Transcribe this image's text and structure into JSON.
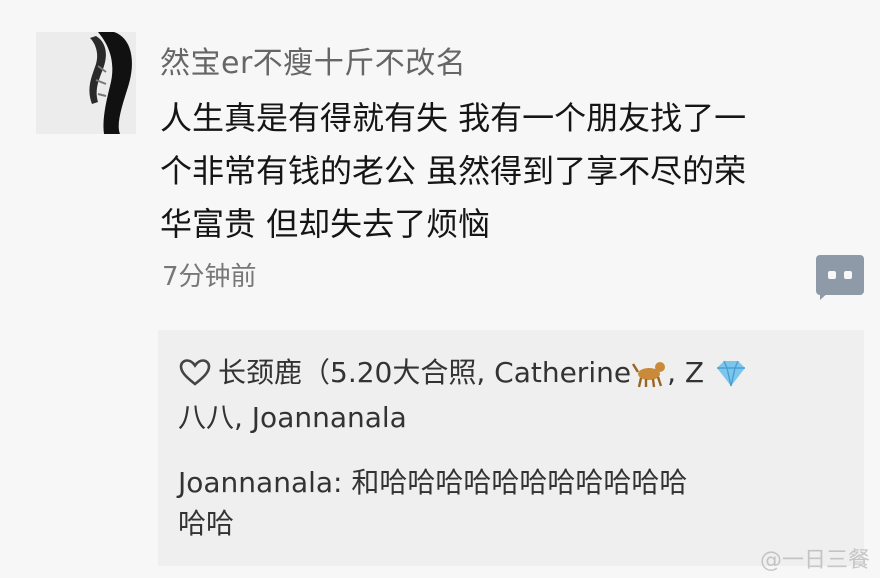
{
  "post": {
    "username": "然宝er不瘦十斤不改名",
    "content_lines": [
      "人生真是有得就有失 我有一个朋友找了一",
      "个非常有钱的老公 虽然得到了享不尽的荣",
      "华富贵 但却失去了烦恼"
    ],
    "time": "7分钟前"
  },
  "likes": {
    "row1_text": "长颈鹿（5.20大合照, Catherine",
    "row1_tail": ", Z ",
    "row2_text": "八八, Joannanala",
    "icons": [
      "heart-outline-icon",
      "dog-emoji-icon",
      "diamond-emoji-icon"
    ]
  },
  "reply": {
    "lines": [
      "Joannanala: 和哈哈哈哈哈哈哈哈哈哈哈",
      "哈哈"
    ]
  },
  "watermark": "@一日三餐",
  "colors": {
    "background": "#f7f7f7",
    "reply_box": "#efefef",
    "comment_button": "#8e9aa8"
  }
}
